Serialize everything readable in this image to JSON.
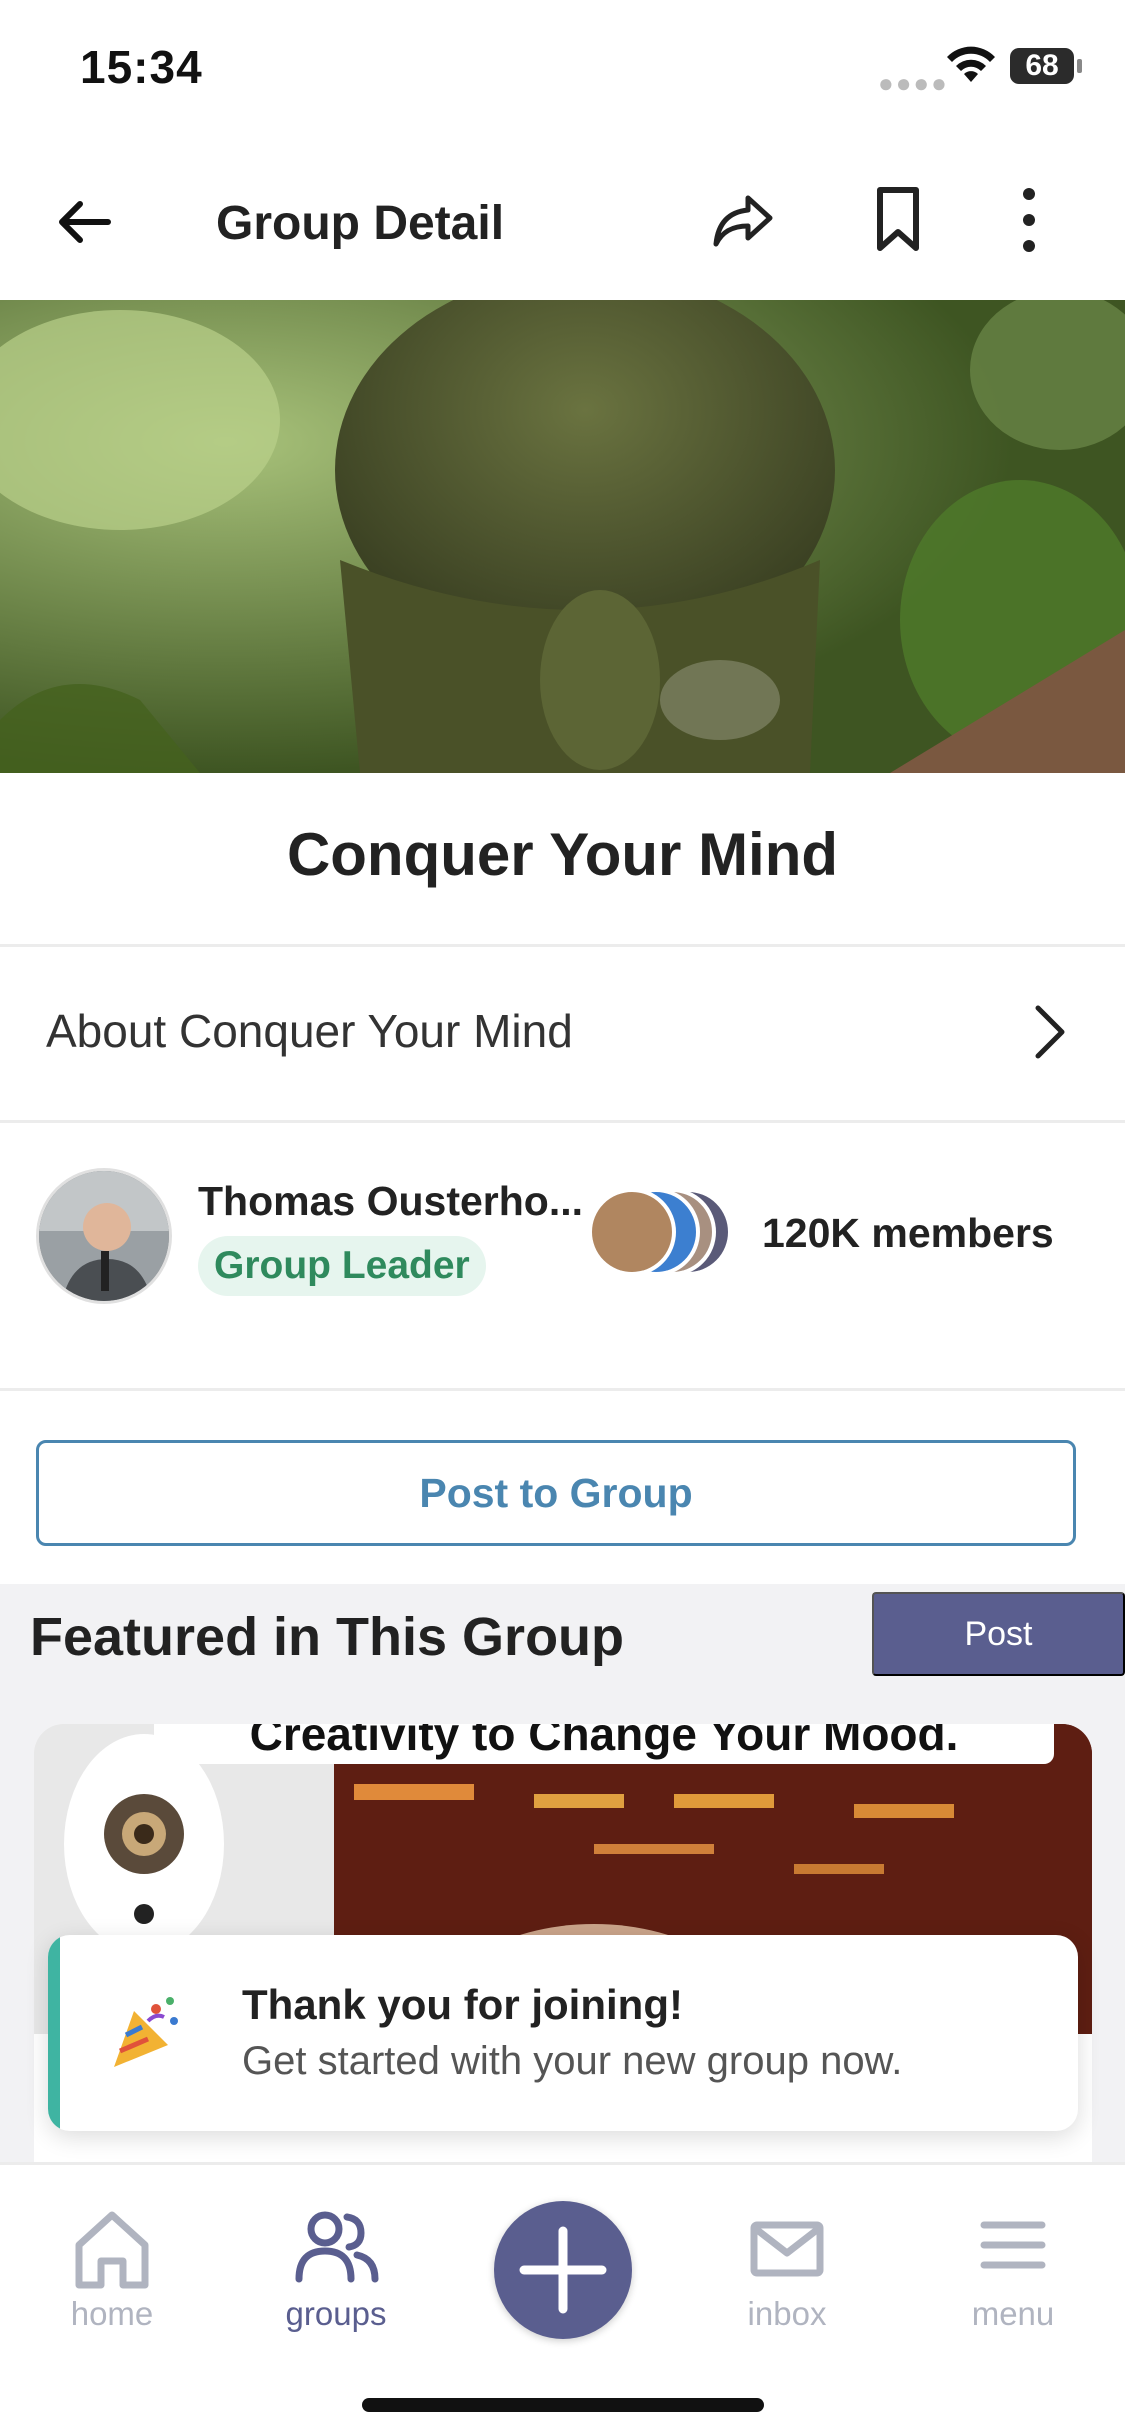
{
  "status_bar": {
    "time": "15:34",
    "battery": "68"
  },
  "app_bar": {
    "title": "Group Detail"
  },
  "group": {
    "name": "Conquer Your Mind",
    "about_label": "About Conquer Your Mind",
    "leader": {
      "name": "Thomas Ousterho...",
      "role": "Group Leader"
    },
    "members_label": "120K members",
    "post_button": "Post to Group"
  },
  "featured": {
    "title": "Featured in This Group",
    "post_button": "Post",
    "card_caption": "Creativity to Change Your Mood."
  },
  "toast": {
    "title": "Thank you for joining!",
    "message": "Get started with your new group now."
  },
  "bottom_nav": {
    "items": [
      {
        "label": "home",
        "icon": "home-icon"
      },
      {
        "label": "groups",
        "icon": "groups-icon",
        "active": true
      },
      {
        "label": "add",
        "icon": "plus-icon"
      },
      {
        "label": "inbox",
        "icon": "envelope-icon"
      },
      {
        "label": "menu",
        "icon": "hamburger-icon"
      }
    ]
  },
  "colors": {
    "accent": "#5a5e8f",
    "link_blue": "#4a86b0",
    "leader_badge_bg": "#e6f5ee",
    "leader_badge_text": "#2f8a5d",
    "toast_bar": "#3fb4a2"
  }
}
